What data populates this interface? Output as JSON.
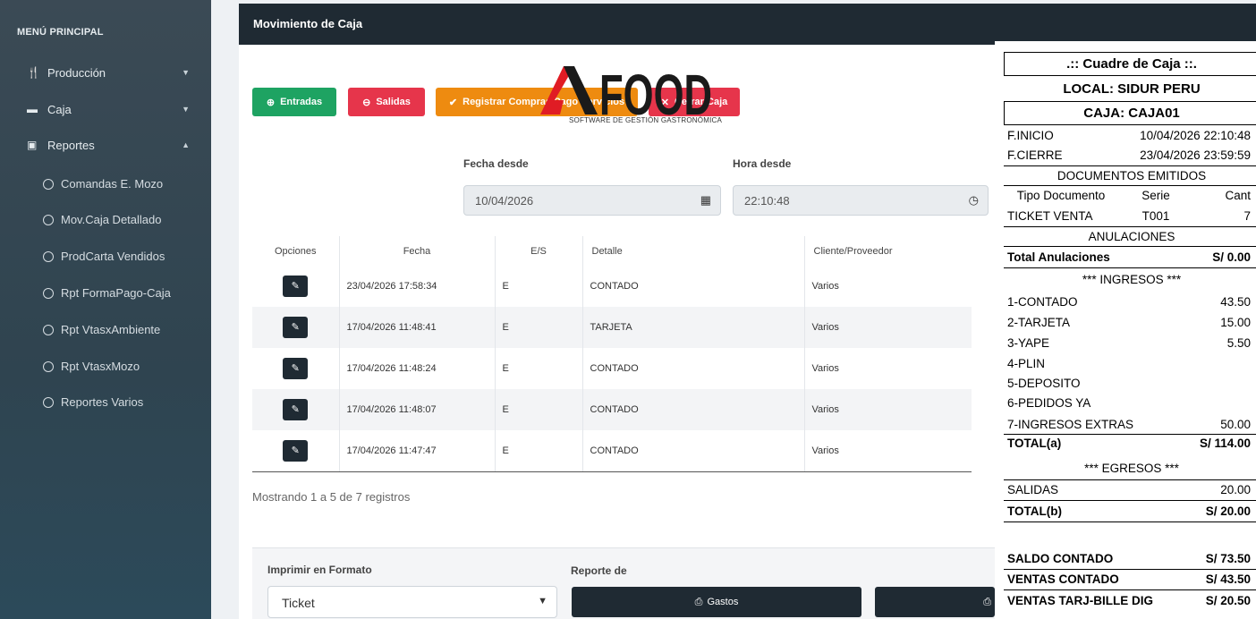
{
  "sidebar": {
    "title": "MENÚ PRINCIPAL",
    "items": [
      {
        "label": "Producción",
        "icon": "utensils-icon",
        "expanded": false
      },
      {
        "label": "Caja",
        "icon": "cash-register-icon",
        "expanded": false
      },
      {
        "label": "Reportes",
        "icon": "money-bill-icon",
        "expanded": true
      }
    ],
    "sub_items": [
      {
        "label": "Comandas E. Mozo"
      },
      {
        "label": "Mov.Caja Detallado"
      },
      {
        "label": "ProdCarta Vendidos"
      },
      {
        "label": "Rpt FormaPago-Caja"
      },
      {
        "label": "Rpt VtasxAmbiente"
      },
      {
        "label": "Rpt VtasxMozo"
      },
      {
        "label": "Reportes Varios"
      }
    ]
  },
  "header": {
    "title": "Movimiento de Caja"
  },
  "actions": {
    "entradas": "Entradas",
    "salidas": "Salidas",
    "compras": "Registrar Compras/Pago Servicios",
    "cerrar": "Cerrar Caja"
  },
  "logo": {
    "brand": "AFOOD",
    "tagline": "SOFTWARE DE GESTIÓN GASTRONÓMICA",
    "accent": "#e01c24"
  },
  "filters": {
    "fecha_label": "Fecha desde",
    "fecha_value": "10/04/2026",
    "hora_label": "Hora desde",
    "hora_value": "22:10:48"
  },
  "table": {
    "headers": [
      "Opciones",
      "Fecha",
      "E/S",
      "Detalle",
      "Cliente/Proveedor"
    ],
    "rows": [
      {
        "fecha": "23/04/2026 17:58:34",
        "es": "E",
        "detalle": "CONTADO",
        "cliente": "Varios"
      },
      {
        "fecha": "17/04/2026 11:48:41",
        "es": "E",
        "detalle": "TARJETA",
        "cliente": "Varios"
      },
      {
        "fecha": "17/04/2026 11:48:24",
        "es": "E",
        "detalle": "CONTADO",
        "cliente": "Varios"
      },
      {
        "fecha": "17/04/2026 11:48:07",
        "es": "E",
        "detalle": "CONTADO",
        "cliente": "Varios"
      },
      {
        "fecha": "17/04/2026 11:47:47",
        "es": "E",
        "detalle": "CONTADO",
        "cliente": "Varios"
      }
    ],
    "showing": "Mostrando 1 a 5 de 7 registros"
  },
  "footer": {
    "imprimir_label": "Imprimir en Formato",
    "formato_value": "Ticket",
    "reporte_label": "Reporte de",
    "gastos_button": "Gastos"
  },
  "receipt": {
    "title": ".:: Cuadre de Caja ::.",
    "local": "LOCAL: SIDUR PERU",
    "caja": "CAJA: CAJA01",
    "f_inicio_label": "F.INICIO",
    "f_inicio": "10/04/2026 22:10:48",
    "f_cierre_label": "F.CIERRE",
    "f_cierre": "23/04/2026 23:59:59",
    "docs_title": "DOCUMENTOS EMITIDOS",
    "docs_headers": [
      "Tipo Documento",
      "Serie",
      "Cant"
    ],
    "docs_row": [
      "TICKET VENTA",
      "T001",
      "7"
    ],
    "anulaciones_title": "ANULACIONES",
    "total_anulaciones_label": "Total Anulaciones",
    "total_anulaciones": "S/  0.00",
    "ingresos_title": "*** INGRESOS ***",
    "ingresos": [
      {
        "label": "1-CONTADO",
        "value": "43.50"
      },
      {
        "label": "2-TARJETA",
        "value": "15.00"
      },
      {
        "label": "3-YAPE",
        "value": "5.50"
      },
      {
        "label": "4-PLIN",
        "value": ""
      },
      {
        "label": "5-DEPOSITO",
        "value": ""
      },
      {
        "label": "6-PEDIDOS YA",
        "value": ""
      },
      {
        "label": "7-INGRESOS EXTRAS",
        "value": "50.00"
      }
    ],
    "total_a_label": "TOTAL(a)",
    "total_a": "S/  114.00",
    "egresos_title": "*** EGRESOS ***",
    "salidas_label": "SALIDAS",
    "salidas": "20.00",
    "total_b_label": "TOTAL(b)",
    "total_b": "S/  20.00",
    "saldo_label": "SALDO CONTADO",
    "saldo": "S/  73.50",
    "ventas_contado_label": "VENTAS CONTADO",
    "ventas_contado": "S/  43.50",
    "ventas_tarj_label": "VENTAS TARJ-BILLE DIG",
    "ventas_tarj": "S/  20.50"
  }
}
